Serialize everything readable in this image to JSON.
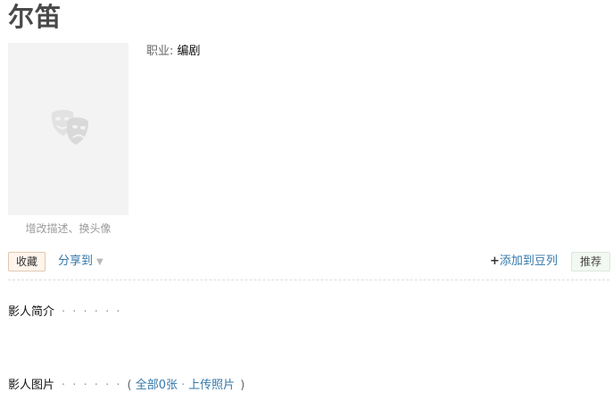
{
  "page": {
    "title": "尔笛"
  },
  "profile": {
    "edit_link": "增改描述、换头像",
    "profession_label": "职业:",
    "profession_value": "编剧"
  },
  "actions": {
    "collect_label": "收藏",
    "share_label": "分享到",
    "share_caret": "▼",
    "add_doulist_plus": "+",
    "add_doulist_label": "添加到豆列",
    "recommend_label": "推荐"
  },
  "sections": {
    "intro_title": "影人简介",
    "intro_dots": "· · · · · ·",
    "photos_title": "影人图片",
    "photos_dots": "· · · · · ·",
    "photos_open": "(",
    "photos_all_link": "全部0张",
    "photos_sep": "·",
    "photos_upload_link": "上传照片",
    "photos_close": ")"
  },
  "colors": {
    "link": "#3377aa",
    "title": "#494949"
  }
}
